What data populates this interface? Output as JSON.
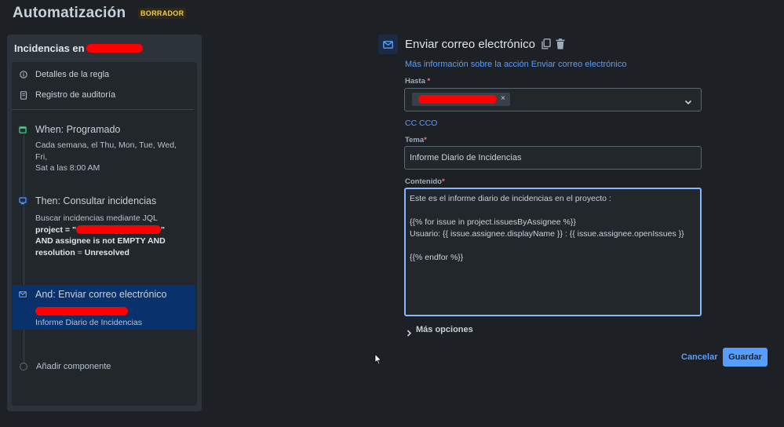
{
  "header": {
    "title": "Automatización",
    "badge": "BORRADOR"
  },
  "panel": {
    "title_prefix": "Incidencias en",
    "menu": [
      {
        "label": "Detalles de la regla",
        "icon": "info-icon"
      },
      {
        "label": "Registro de auditoría",
        "icon": "audit-log-icon"
      }
    ],
    "steps": [
      {
        "title": "When: Programado",
        "sub1": "Cada semana, el Thu, Mon, Tue, Wed, Fri,",
        "sub2": "Sat a las 8:00 AM",
        "icon": "calendar-icon"
      },
      {
        "title": "Then: Consultar incidencias",
        "sub1": "Buscar incidencias mediante JQL",
        "jql_1a": "project",
        "jql_1b": " = \"",
        "jql_1c": "\"",
        "jql_2": "AND assignee is not EMPTY AND",
        "jql_3a": "resolution",
        "jql_3b": " = ",
        "jql_3c": "Unresolved",
        "icon": "search-issues-icon"
      },
      {
        "title": "And: Enviar correo electrónico",
        "sub2": "Informe Diario de Incidencias",
        "icon": "email-icon"
      }
    ],
    "add_component": "Añadir componente"
  },
  "form": {
    "title": "Enviar correo electrónico",
    "more_info": "Más información sobre la acción Enviar correo electrónico",
    "to_label": "Hasta",
    "cc": "CC",
    "bcc": "CCO",
    "subject_label": "Tema",
    "subject_value": "Informe Diario de Incidencias",
    "content_label": "Contenido",
    "content_lines": [
      "Este es el informe diario de incidencias en el proyecto :",
      "{{% for issue in project.issuesByAssignee %}}",
      "Usuario: {{ issue.assignee.displayName }} : {{ issue.assignee.openIssues }}",
      "{{% endfor %}}"
    ],
    "more_options": "Más opciones",
    "cancel": "Cancelar",
    "save": "Guardar",
    "required_mark": "*",
    "chip_remove": "×",
    "dropdown_chevron": "⌄"
  },
  "colors": {
    "accent": "#579dff",
    "background": "#1d2125",
    "selected_step": "#09326c",
    "redaction": "#ff0000"
  }
}
